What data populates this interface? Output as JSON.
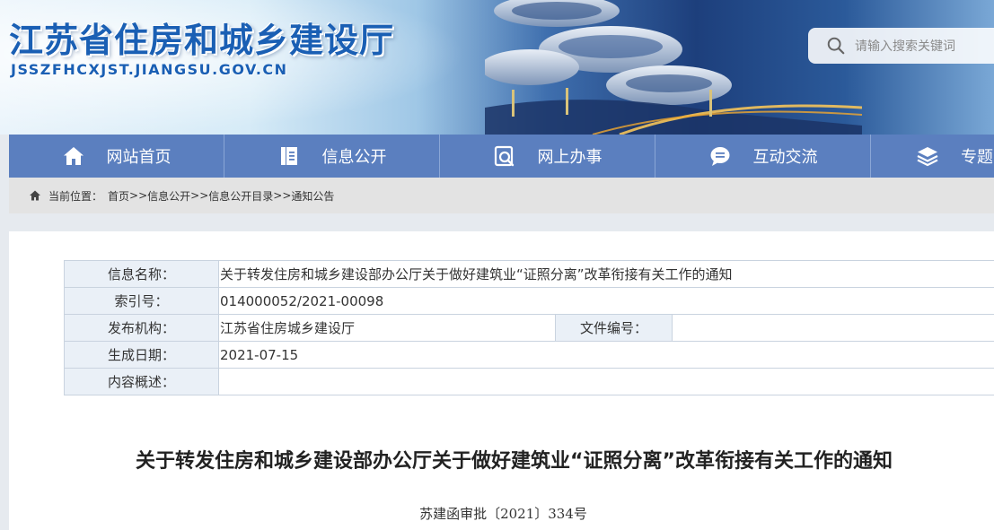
{
  "header": {
    "site_title": "江苏省住房和城乡建设厅",
    "site_domain": "JSSZFHCXJST.JIANGSU.GOV.CN",
    "search_placeholder": "请输入搜索关键词"
  },
  "nav": {
    "items": [
      {
        "label": "网站首页",
        "icon": "home-icon"
      },
      {
        "label": "信息公开",
        "icon": "document-icon"
      },
      {
        "label": "网上办事",
        "icon": "service-icon"
      },
      {
        "label": "互动交流",
        "icon": "chat-bubble-icon"
      },
      {
        "label": "专题",
        "icon": "layers-icon"
      }
    ]
  },
  "breadcrumb": {
    "label": "当前位置：",
    "crumbs": [
      "首页",
      "信息公开",
      "信息公开目录",
      "通知公告"
    ],
    "separator": ">>"
  },
  "meta": {
    "name_label": "信息名称：",
    "name_value": "关于转发住房和城乡建设部办公厅关于做好建筑业“证照分离”改革衔接有关工作的通知",
    "index_label": "索引号：",
    "index_value": "014000052/2021-00098",
    "org_label": "发布机构：",
    "org_value": "江苏省住房城乡建设厅",
    "docno_label": "文件编号：",
    "docno_value": "",
    "date_label": "生成日期：",
    "date_value": "2021-07-15",
    "summary_label": "内容概述：",
    "summary_value": ""
  },
  "document": {
    "title": "关于转发住房和城乡建设部办公厅关于做好建筑业“证照分离”改革衔接有关工作的通知",
    "number": "苏建函审批〔2021〕334号"
  },
  "colors": {
    "nav_bg": "#5b7fbf",
    "title_blue": "#1a5fb4",
    "table_label_bg": "#eaf0f7"
  }
}
